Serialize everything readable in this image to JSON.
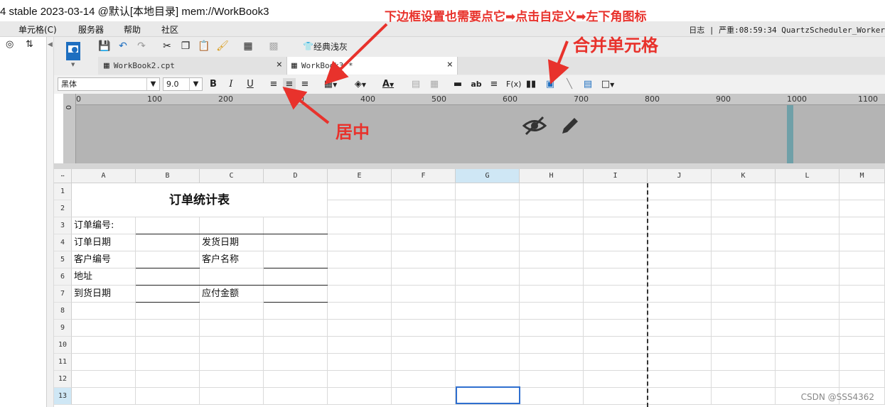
{
  "title_bar": {
    "text": "4 stable 2023-03-14 @默认[本地目录]    mem://WorkBook3"
  },
  "menu": {
    "items": [
      "单元格(C)",
      "服务器",
      "帮助",
      "社区"
    ],
    "right_text": "日志 | 严重:08:59:34 QuartzScheduler_Worker"
  },
  "toolbar": {
    "theme_label": "经典浅灰"
  },
  "tabs": [
    {
      "label": "WorkBook2.cpt",
      "close": "×"
    },
    {
      "label": "WorkBook3 *",
      "close": "×"
    }
  ],
  "format": {
    "font_name": "黑体",
    "font_size": "9.0",
    "bold": "B",
    "italic": "I",
    "underline": "U"
  },
  "ruler": {
    "labels": [
      "0",
      "100",
      "200",
      "300",
      "400",
      "500",
      "600",
      "700",
      "800",
      "900",
      "1000",
      "1100"
    ],
    "side_label": "0"
  },
  "grid": {
    "columns": [
      "A",
      "B",
      "C",
      "D",
      "E",
      "F",
      "G",
      "H",
      "I",
      "J",
      "K",
      "L",
      "M"
    ],
    "rows": [
      "1",
      "2",
      "3",
      "4",
      "5",
      "6",
      "7",
      "8",
      "9",
      "10",
      "11",
      "12",
      "13"
    ],
    "cells": {
      "title": "订单统计表",
      "r3a": "订单编号:",
      "r4a": "订单日期",
      "r4c": "发货日期",
      "r5a": "客户编号",
      "r5c": "客户名称",
      "r6a": "地址",
      "r7a": "到货日期",
      "r7c": "应付金额"
    }
  },
  "annotations": {
    "border_note": "下边框设置也需要点它➡点击自定义➡左下角图标",
    "merge_note": "合并单元格",
    "center_note": "居中"
  },
  "watermark": "CSDN @SSS4362",
  "colors": {
    "annotation": "#e8322c",
    "selection": "#2f6fcf",
    "accent": "#1e6fc0"
  }
}
